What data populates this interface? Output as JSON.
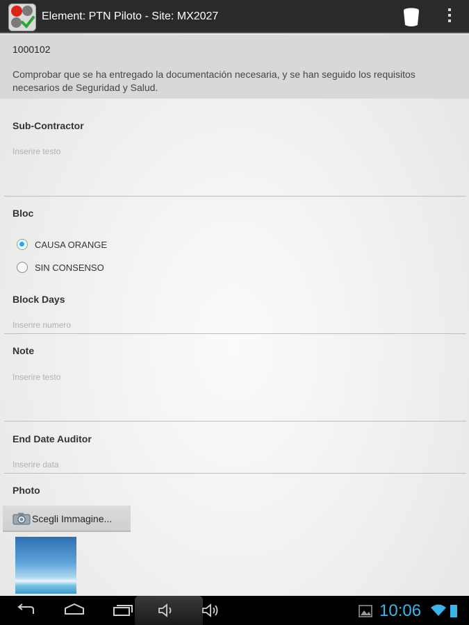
{
  "actionbar": {
    "title": "Element: PTN Piloto  - Site: MX2027",
    "icons": [
      "app-logo-icon",
      "trash-icon",
      "overflow-menu-icon"
    ]
  },
  "header": {
    "id": "1000102",
    "description": "Comprobar que se ha entregado la documentación necesaria, y se  han seguido los requisitos necesarios de Seguridad y Salud."
  },
  "form": {
    "subcontractor": {
      "label": "Sub-Contractor",
      "placeholder": "Inserire testo"
    },
    "bloc": {
      "label": "Bloc",
      "options": [
        {
          "label": "CAUSA ORANGE",
          "checked": true
        },
        {
          "label": "SIN CONSENSO",
          "checked": false
        }
      ]
    },
    "block_days": {
      "label": "Block Days",
      "placeholder": "Inserire numero"
    },
    "note": {
      "label": "Note",
      "placeholder": "Inserire testo"
    },
    "end_date": {
      "label": "End Date Auditor",
      "placeholder": "Inserire data"
    },
    "photo": {
      "label": "Photo",
      "button_label": "Scegli Immagine..."
    }
  },
  "statusbar": {
    "time": "10:06",
    "icons": [
      "back-icon",
      "home-icon",
      "recents-icon",
      "volume-down-icon",
      "volume-up-icon",
      "gallery-icon",
      "wifi-icon",
      "battery-icon"
    ]
  },
  "colors": {
    "accent": "#2aa6e6",
    "clock": "#3bb5e8",
    "actionbar": "#2a2a2a"
  }
}
